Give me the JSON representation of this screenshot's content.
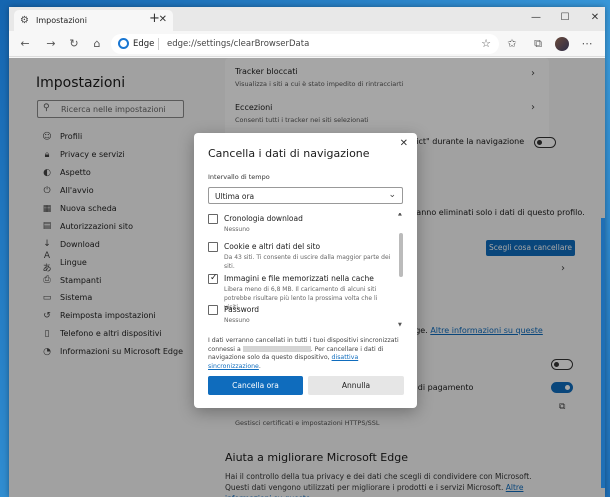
{
  "tab": {
    "title": "Impostazioni",
    "close": "✕",
    "new": "+"
  },
  "window_controls": {
    "minimize": "—",
    "maximize": "☐",
    "close": "✕"
  },
  "address": {
    "site": "Edge",
    "url": "edge://settings/clearBrowserData"
  },
  "sidebar": {
    "title": "Impostazioni",
    "search_placeholder": "Ricerca nelle impostazioni",
    "items": [
      {
        "label": "Profili",
        "icon": "profile-icon"
      },
      {
        "label": "Privacy e servizi",
        "icon": "lock-icon"
      },
      {
        "label": "Aspetto",
        "icon": "appearance-icon"
      },
      {
        "label": "All'avvio",
        "icon": "power-icon"
      },
      {
        "label": "Nuova scheda",
        "icon": "newtab-icon"
      },
      {
        "label": "Autorizzazioni sito",
        "icon": "site-permissions-icon"
      },
      {
        "label": "Download",
        "icon": "download-icon"
      },
      {
        "label": "Lingue",
        "icon": "languages-icon"
      },
      {
        "label": "Stampanti",
        "icon": "printer-icon"
      },
      {
        "label": "Sistema",
        "icon": "system-icon"
      },
      {
        "label": "Reimposta impostazioni",
        "icon": "reset-icon"
      },
      {
        "label": "Telefono e altri dispositivi",
        "icon": "phone-icon"
      },
      {
        "label": "Informazioni su Microsoft Edge",
        "icon": "edge-icon"
      }
    ]
  },
  "main": {
    "tracker_blocked_title": "Tracker bloccati",
    "tracker_blocked_sub": "Visualizza i siti a cui è stato impedito di rintracciarti",
    "exceptions_title": "Eccezioni",
    "exceptions_sub": "Consenti tutti i tracker nei siti selezionati",
    "strict_text": "rict\" durante la navigazione",
    "delete_text": "ranno eliminati solo i dati di questo profilo.",
    "choose_button": "Scegli cosa cancellare",
    "sync_text": "lge.",
    "sync_link": "Altre informazioni su queste",
    "payment_text": "i di pagamento",
    "certs_text": "Gestisci certificati e impostazioni HTTPS/SSL",
    "help_title": "Aiuta a migliorare Microsoft Edge",
    "help_text": "Hai il controllo della tua privacy e dei dati che scegli di condividere con Microsoft. Questi dati vengono utilizzati per migliorare i prodotti e i servizi Microsoft.",
    "help_link": "Altre informazioni su queste"
  },
  "dialog": {
    "title": "Cancella i dati di navigazione",
    "interval_label": "Intervallo di tempo",
    "interval_value": "Ultima ora",
    "options": [
      {
        "title": "Cronologia download",
        "sub": "Nessuno",
        "checked": false
      },
      {
        "title": "Cookie e altri dati del sito",
        "sub": "Da 43 siti. Ti consente di uscire dalla maggior parte dei siti.",
        "checked": false
      },
      {
        "title": "Immagini e file memorizzati nella cache",
        "sub": "Libera meno di 6,8 MB. Il caricamento di alcuni siti potrebbe risultare più lento la prossima volta che li visiti.",
        "checked": true
      },
      {
        "title": "Password",
        "sub": "Nessuno",
        "checked": false
      }
    ],
    "note_before": "I dati verranno cancellati in tutti i tuoi dispositivi sincronizzati connessi a",
    "note_after": ". Per cancellare i dati di navigazione solo da questo dispositivo,",
    "note_link": "disattiva sincronizzazione",
    "note_end": ".",
    "primary": "Cancella ora",
    "secondary": "Annulla"
  }
}
